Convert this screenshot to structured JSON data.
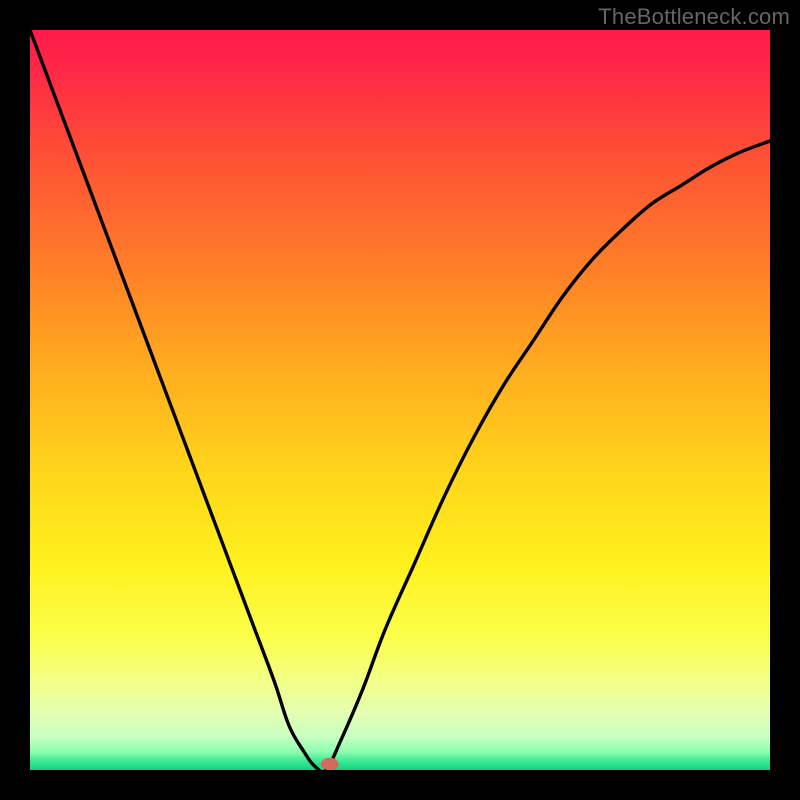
{
  "watermark": {
    "text": "TheBottleneck.com"
  },
  "chart_data": {
    "type": "line",
    "title": "",
    "xlabel": "",
    "ylabel": "",
    "xlim": [
      0,
      100
    ],
    "ylim": [
      0,
      100
    ],
    "gradient_stops": [
      {
        "offset": 0.0,
        "color": "#ff1a4b"
      },
      {
        "offset": 0.06,
        "color": "#ff2a45"
      },
      {
        "offset": 0.18,
        "color": "#ff5334"
      },
      {
        "offset": 0.32,
        "color": "#ff7e28"
      },
      {
        "offset": 0.46,
        "color": "#ffad1f"
      },
      {
        "offset": 0.6,
        "color": "#ffd61b"
      },
      {
        "offset": 0.72,
        "color": "#fff01e"
      },
      {
        "offset": 0.82,
        "color": "#fbff4a"
      },
      {
        "offset": 0.88,
        "color": "#f2ff86"
      },
      {
        "offset": 0.92,
        "color": "#e6ffb0"
      },
      {
        "offset": 0.955,
        "color": "#c8ffc2"
      },
      {
        "offset": 0.975,
        "color": "#8dffb0"
      },
      {
        "offset": 0.99,
        "color": "#33e48f"
      },
      {
        "offset": 1.0,
        "color": "#14d184"
      }
    ],
    "curve": {
      "x": [
        0,
        3,
        6,
        9,
        12,
        15,
        18,
        21,
        24,
        27,
        30,
        33,
        35,
        37,
        38.5,
        40,
        42,
        45,
        48,
        52,
        56,
        60,
        64,
        68,
        72,
        76,
        80,
        84,
        88,
        92,
        96,
        100
      ],
      "y": [
        100,
        92,
        84,
        76,
        68,
        60,
        52,
        44,
        36,
        28,
        20,
        12,
        6,
        2.5,
        0.5,
        0,
        4,
        11,
        19,
        28,
        37,
        45,
        52,
        58,
        64,
        69,
        73,
        76.5,
        79,
        81.5,
        83.5,
        85
      ]
    },
    "marker": {
      "x": 40.5,
      "y": 0.8,
      "rx": 1.2,
      "ry": 0.85,
      "color": "#d46a5e"
    }
  }
}
